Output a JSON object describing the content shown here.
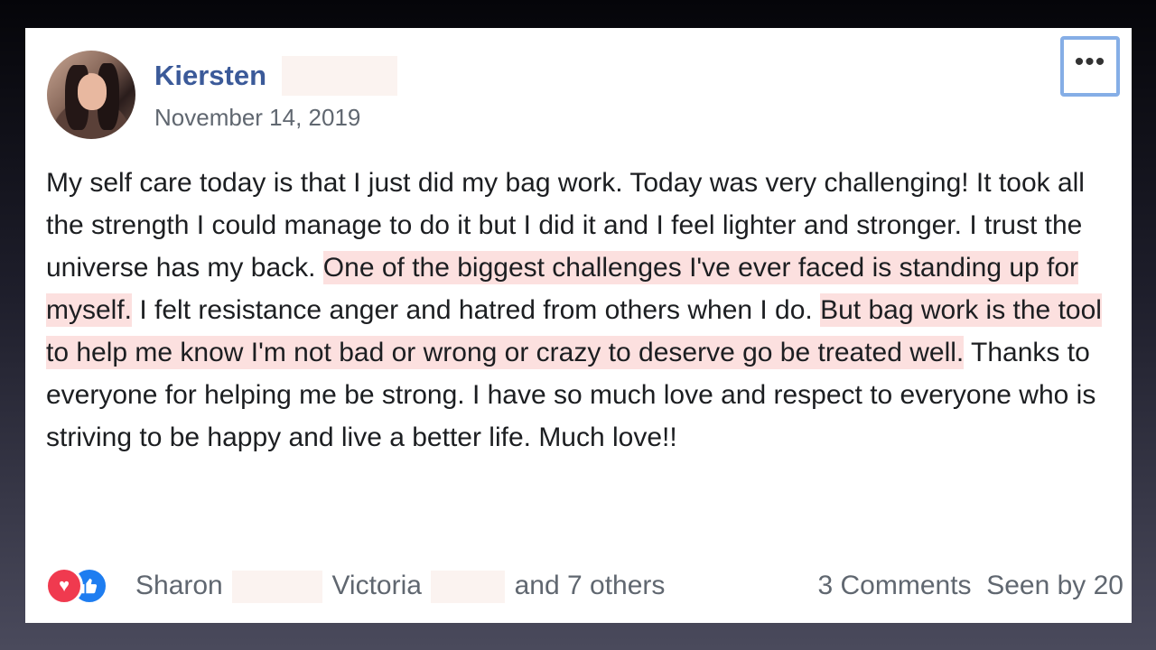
{
  "post": {
    "author_name": "Kiersten",
    "date": "November 14, 2019",
    "more_icon": "more-options-icon",
    "more_glyph": "•••",
    "text": {
      "p1": "My self care today is that I just did my bag work. Today was very challenging! It took all the strength I could manage to do it but I did it and I feel lighter and stronger. I trust the universe has my back. ",
      "h1": "One of the biggest challenges I've ever faced is standing up for myself.",
      "p2": " I felt resistance anger and hatred from others when I do. ",
      "h2": "But bag work is the tool to help me know I'm not bad or wrong or crazy to deserve go be treated well.",
      "p3": " Thanks to everyone for helping me be strong. I have so much love and respect to everyone who is striving to be happy and live a better life. Much love!!"
    },
    "highlight_color": "#fce0df"
  },
  "footer": {
    "reactions": [
      {
        "icon": "heart-icon",
        "glyph": "♥",
        "color": "#f03a4f"
      },
      {
        "icon": "thumbs-up-icon",
        "glyph": "👍",
        "color": "#1e7df0"
      }
    ],
    "reactor_1": "Sharon",
    "reactor_2": "Victoria",
    "others": "and 7 others",
    "comments": "3 Comments",
    "seen": "Seen by 20"
  }
}
